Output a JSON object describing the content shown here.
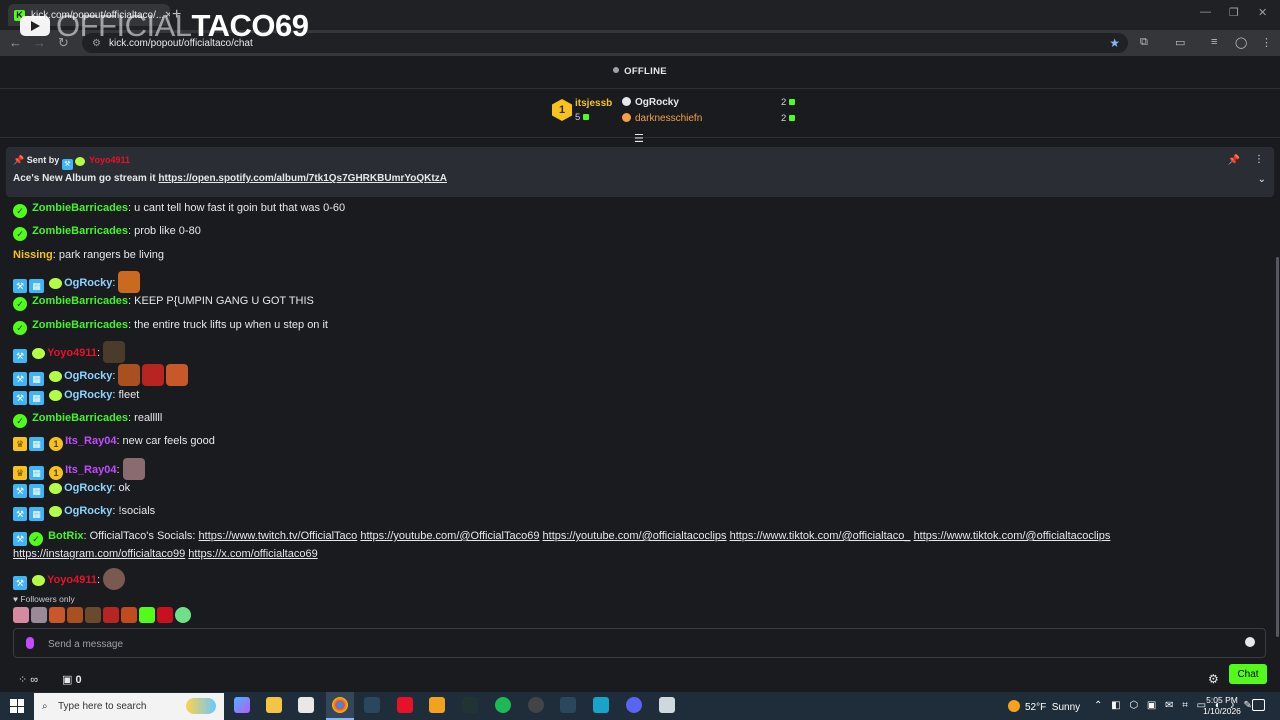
{
  "browser": {
    "tab_title": "kick.com/popout/officialtaco/...",
    "url": "kick.com/popout/officialtaco/chat",
    "overlay_logo_thin": "OFFICIAL",
    "overlay_logo_bold": "TACO69"
  },
  "stream_status": "OFFLINE",
  "leaderboard": {
    "first": {
      "rank": "1",
      "name": "itsjessb",
      "count": "5"
    },
    "second": {
      "name": "OgRocky",
      "count": "2"
    },
    "third": {
      "name": "darknesschiefn",
      "count": "2"
    }
  },
  "pinned": {
    "sent_by_label": "Sent by",
    "sender": "Yoyo4911",
    "text": "Ace's New Album go stream it ",
    "link": "https://open.spotify.com/album/7tk1Qs7GHRKBUmrYoQKtzA"
  },
  "messages": [
    {
      "user": "ZombieBarricades",
      "text": ": u cant tell how fast it goin but that was 0-60"
    },
    {
      "user": "ZombieBarricades",
      "text": ": prob like 0-80"
    },
    {
      "user": "Nissing",
      "text": ": park rangers be living"
    },
    {
      "user": "OgRocky",
      "text": ":"
    },
    {
      "user": "ZombieBarricades",
      "text": ": KEEP P{UMPIN GANG U GOT THIS"
    },
    {
      "user": "ZombieBarricades",
      "text": ": the entire truck lifts up when u step on it"
    },
    {
      "user": "Yoyo4911",
      "text": ":"
    },
    {
      "user": "OgRocky",
      "text": ":"
    },
    {
      "user": "OgRocky",
      "text": ": fleet"
    },
    {
      "user": "ZombieBarricades",
      "text": ": realllll"
    },
    {
      "user": "Its_Ray04",
      "text": ": new car feels good"
    },
    {
      "user": "Its_Ray04",
      "text": ":"
    },
    {
      "user": "OgRocky",
      "text": ": ok"
    },
    {
      "user": "OgRocky",
      "text": ": !socials"
    },
    {
      "user": "BotRix",
      "text": ": OfficialTaco's Socials: ",
      "links": [
        "https://www.twitch.tv/OfficialTaco",
        "https://youtube.com/@OfficialTaco69",
        "https://youtube.com/@officialtacoclips",
        "https://www.tiktok.com/@officialtaco_",
        "https://www.tiktok.com/@officialtacoclips",
        "https://instagram.com/officialtaco99",
        "https://x.com/officialtaco69"
      ]
    },
    {
      "user": "Yoyo4911",
      "text": ":"
    }
  ],
  "chat_mode": "Followers only",
  "input_placeholder": "Send a message",
  "footer": {
    "points": "∞",
    "bank": "0",
    "chat_button": "Chat"
  },
  "taskbar": {
    "search_placeholder": "Type here to search",
    "temperature": "52°F",
    "condition": "Sunny",
    "time": "5:05 PM",
    "date": "1/10/2026"
  },
  "colors": {
    "kick_green": "#53fc18",
    "pin_bg": "#2a2d33",
    "page_bg": "#191b1f"
  }
}
